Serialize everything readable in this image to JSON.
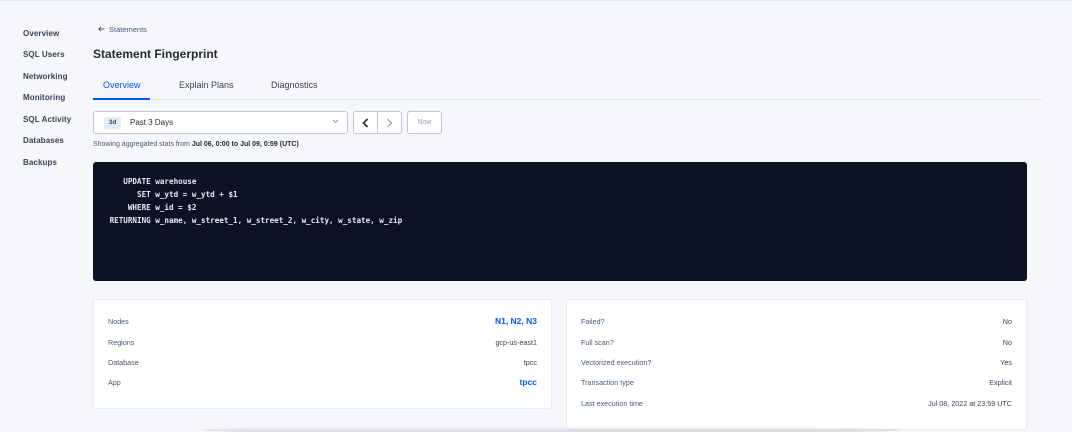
{
  "sidebar": {
    "items": [
      {
        "label": "Overview"
      },
      {
        "label": "SQL Users"
      },
      {
        "label": "Networking"
      },
      {
        "label": "Monitoring"
      },
      {
        "label": "SQL Activity"
      },
      {
        "label": "Databases"
      },
      {
        "label": "Backups"
      }
    ]
  },
  "header": {
    "back_label": "Statements",
    "title": "Statement Fingerprint"
  },
  "tabs": [
    {
      "label": "Overview",
      "active": true
    },
    {
      "label": "Explain Plans",
      "active": false
    },
    {
      "label": "Diagnostics",
      "active": false
    }
  ],
  "time_picker": {
    "badge": "3d",
    "label": "Past 3 Days",
    "now_label": "Now"
  },
  "range": {
    "prefix": "Showing aggregated stats from ",
    "value": "Jul 06, 0:00 to Jul 09, 0:59 (UTC)"
  },
  "sql": {
    "lines": [
      "    UPDATE warehouse",
      "       SET w_ytd = w_ytd + $1",
      "     WHERE w_id = $2",
      " RETURNING w_name, w_street_1, w_street_2, w_city, w_state, w_zip"
    ]
  },
  "left_card": {
    "rows": [
      {
        "key": "Nodes",
        "value": "N1, N2, N3"
      },
      {
        "key": "Regions",
        "value": "gcp-us-east1"
      },
      {
        "key": "Database",
        "value": "tpcc"
      },
      {
        "key": "App",
        "value": "tpcc"
      }
    ]
  },
  "right_card": {
    "rows": [
      {
        "key": "Failed?",
        "value": "No"
      },
      {
        "key": "Full scan?",
        "value": "No"
      },
      {
        "key": "Vectorized execution?",
        "value": "Yes"
      },
      {
        "key": "Transaction type",
        "value": "Explicit"
      },
      {
        "key": "Last execution time",
        "value": "Jul 08, 2022 at 23:59 UTC"
      }
    ]
  },
  "colors": {
    "accent": "#0055ff",
    "sql_background": "#0b1223",
    "page_background": "#f5f7fa"
  }
}
